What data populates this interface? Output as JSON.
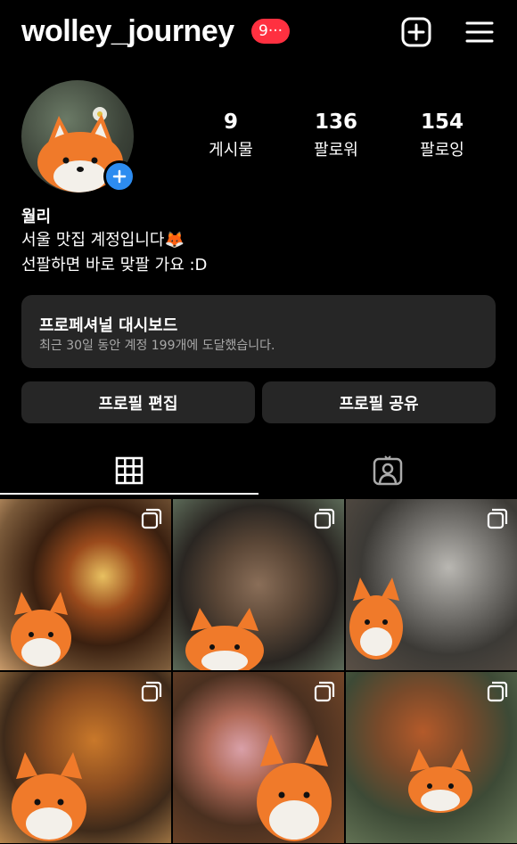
{
  "header": {
    "username": "wolley_journey",
    "notification_badge": "9···",
    "create_icon": "plus-square-icon",
    "menu_icon": "hamburger-menu-icon"
  },
  "profile": {
    "display_name": "월리",
    "bio_line1": "서울 맛집 계정입니다🦊",
    "bio_line2": "선팔하면 바로 맞팔 가요 :D",
    "stats": {
      "posts": {
        "value": "9",
        "label": "게시물"
      },
      "followers": {
        "value": "136",
        "label": "팔로워"
      },
      "following": {
        "value": "154",
        "label": "팔로잉"
      }
    }
  },
  "dashboard": {
    "title": "프로페셔널 대시보드",
    "subtitle": "최근 30일 동안 계정 199개에 도달했습니다."
  },
  "actions": {
    "edit_profile": "프로필 편집",
    "share_profile": "프로필 공유"
  },
  "tabs": [
    {
      "icon": "grid-icon",
      "active": true
    },
    {
      "icon": "tagged-person-icon",
      "active": false
    }
  ],
  "colors": {
    "background": "#000000",
    "card": "#262626",
    "badge": "#ff3040",
    "accent_blue": "#2d8cf0",
    "muted_text": "#a8a8a8"
  }
}
